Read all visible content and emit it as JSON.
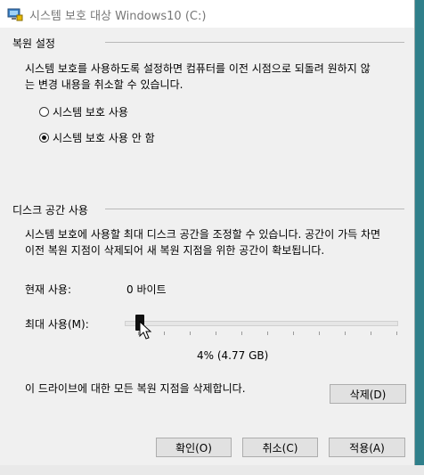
{
  "window": {
    "title": "시스템 보호 대상 Windows10 (C:)"
  },
  "restore_settings": {
    "section_title": "복원 설정",
    "description_line1": "시스템 보호를 사용하도록 설정하면 컴퓨터를 이전 시점으로 되돌려 원하지 않",
    "description_line2": "는 변경 내용을 취소할 수 있습니다.",
    "options": [
      {
        "label": "시스템 보호 사용",
        "selected": false
      },
      {
        "label": "시스템 보호 사용 안 함",
        "selected": true
      }
    ]
  },
  "disk_usage": {
    "section_title": "디스크 공간 사용",
    "description_line1": "시스템 보호에 사용할 최대 디스크 공간을 조정할 수 있습니다. 공간이 가득 차면",
    "description_line2": "이전 복원 지점이 삭제되어 새 복원 지점을 위한 공간이 확보됩니다.",
    "current_label": "현재 사용:",
    "current_value": "0 바이트",
    "max_label": "최대 사용(M):",
    "max_value_text": "4% (4.77 GB)",
    "max_fraction": 0.04,
    "delete_text": "이 드라이브에 대한 모든 복원 지점을 삭제합니다.",
    "delete_button": "삭제(D)"
  },
  "footer": {
    "ok_button": "확인(O)",
    "cancel_button": "취소(C)",
    "apply_button": "적용(A)"
  }
}
